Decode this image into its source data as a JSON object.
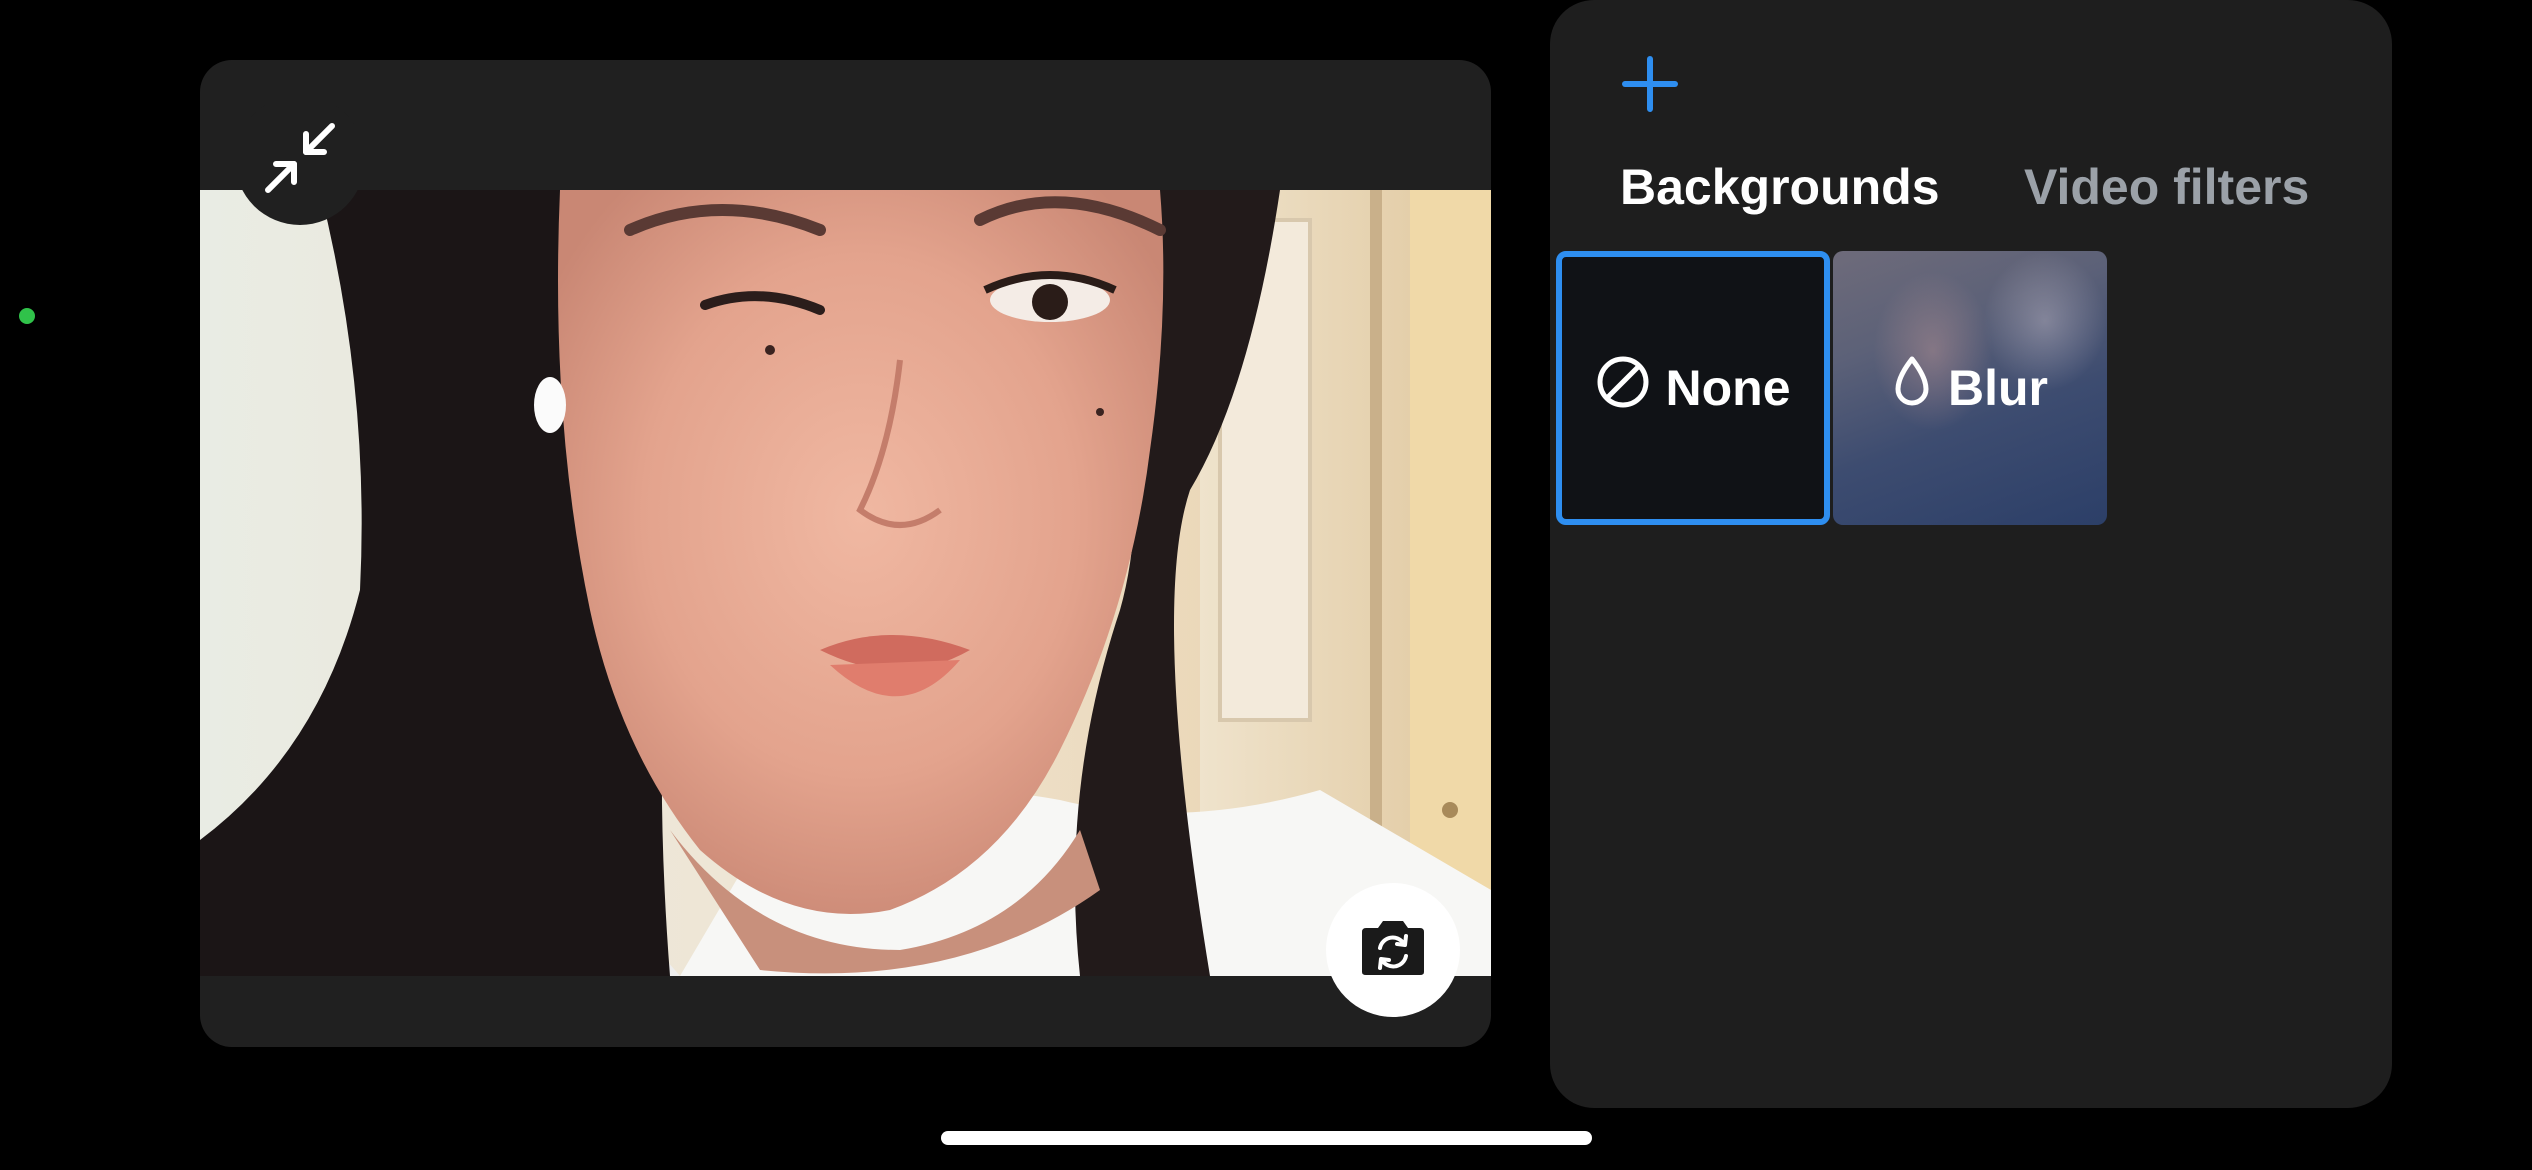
{
  "status": {
    "indicator_color": "#30c24a"
  },
  "video_preview": {
    "collapse_icon": "collapse-arrows-icon",
    "flip_camera_icon": "camera-flip-icon",
    "frame_background": "#202020"
  },
  "effects_panel": {
    "add_icon": "plus-icon",
    "accent_color": "#2e8ef0",
    "tabs": [
      {
        "label": "Backgrounds",
        "selected": true
      },
      {
        "label": "Video filters",
        "selected": false
      }
    ],
    "tiles": [
      {
        "label": "None",
        "icon": "no-effect-icon",
        "selected": true
      },
      {
        "label": "Blur",
        "icon": "blur-drop-icon",
        "selected": false
      }
    ]
  }
}
